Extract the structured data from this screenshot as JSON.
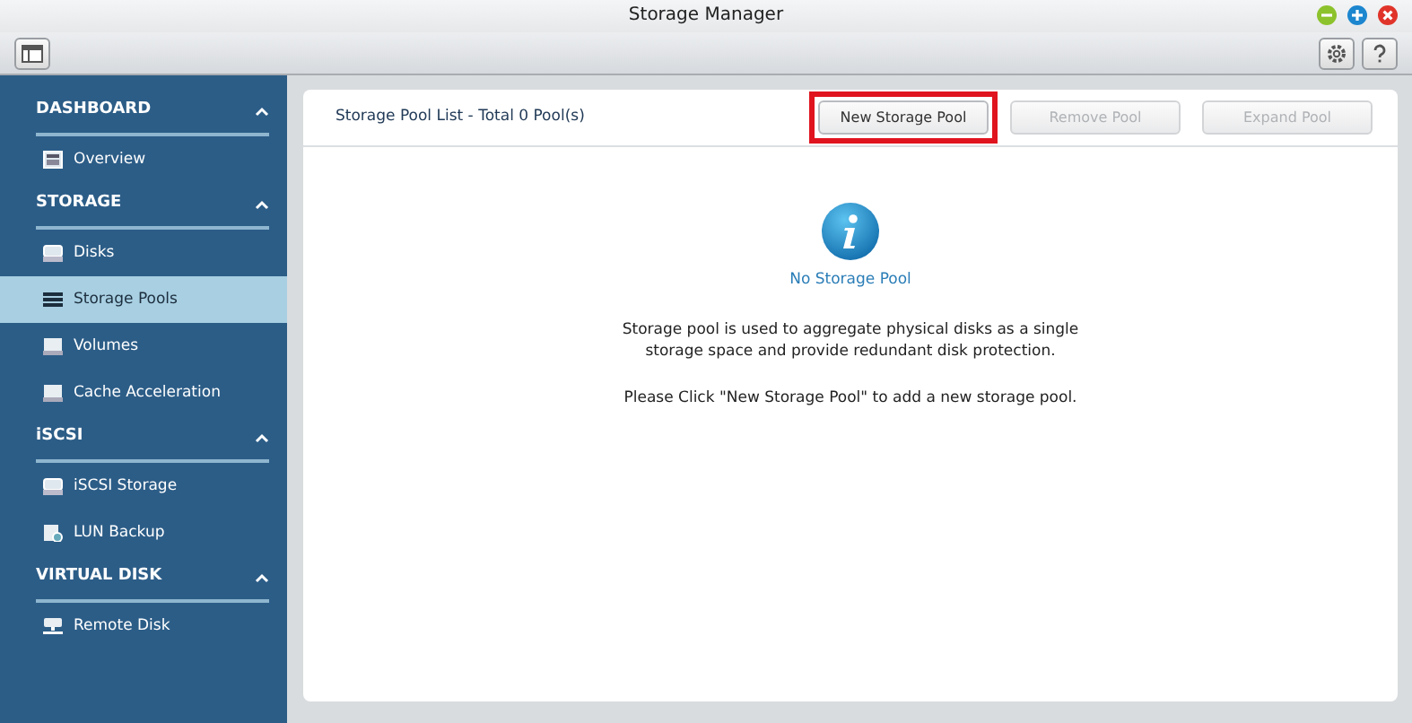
{
  "window": {
    "title": "Storage Manager"
  },
  "sidebar": {
    "sections": [
      {
        "title": "DASHBOARD",
        "expanded": true,
        "items": [
          {
            "label": "Overview",
            "kind": "overview",
            "selected": false
          }
        ]
      },
      {
        "title": "STORAGE",
        "expanded": true,
        "items": [
          {
            "label": "Disks",
            "kind": "disk",
            "selected": false
          },
          {
            "label": "Storage Pools",
            "kind": "pool",
            "selected": true
          },
          {
            "label": "Volumes",
            "kind": "volume",
            "selected": false
          },
          {
            "label": "Cache Acceleration",
            "kind": "volume",
            "selected": false
          }
        ]
      },
      {
        "title": "iSCSI",
        "expanded": true,
        "items": [
          {
            "label": "iSCSI Storage",
            "kind": "disk",
            "selected": false
          },
          {
            "label": "LUN Backup",
            "kind": "backup",
            "selected": false
          }
        ]
      },
      {
        "title": "VIRTUAL DISK",
        "expanded": true,
        "items": [
          {
            "label": "Remote Disk",
            "kind": "remote",
            "selected": false
          }
        ]
      }
    ]
  },
  "panel": {
    "title": "Storage Pool List - Total 0 Pool(s)",
    "buttons": [
      {
        "label": "New Storage Pool",
        "disabled": false,
        "highlighted": true
      },
      {
        "label": "Remove Pool",
        "disabled": true,
        "highlighted": false
      },
      {
        "label": "Expand Pool",
        "disabled": true,
        "highlighted": false
      }
    ],
    "empty": {
      "heading": "No Storage Pool",
      "description": "Storage pool is used to aggregate physical disks as a single storage space and provide redundant disk protection.",
      "hint": "Please Click \"New Storage Pool\" to add a new storage pool."
    }
  }
}
